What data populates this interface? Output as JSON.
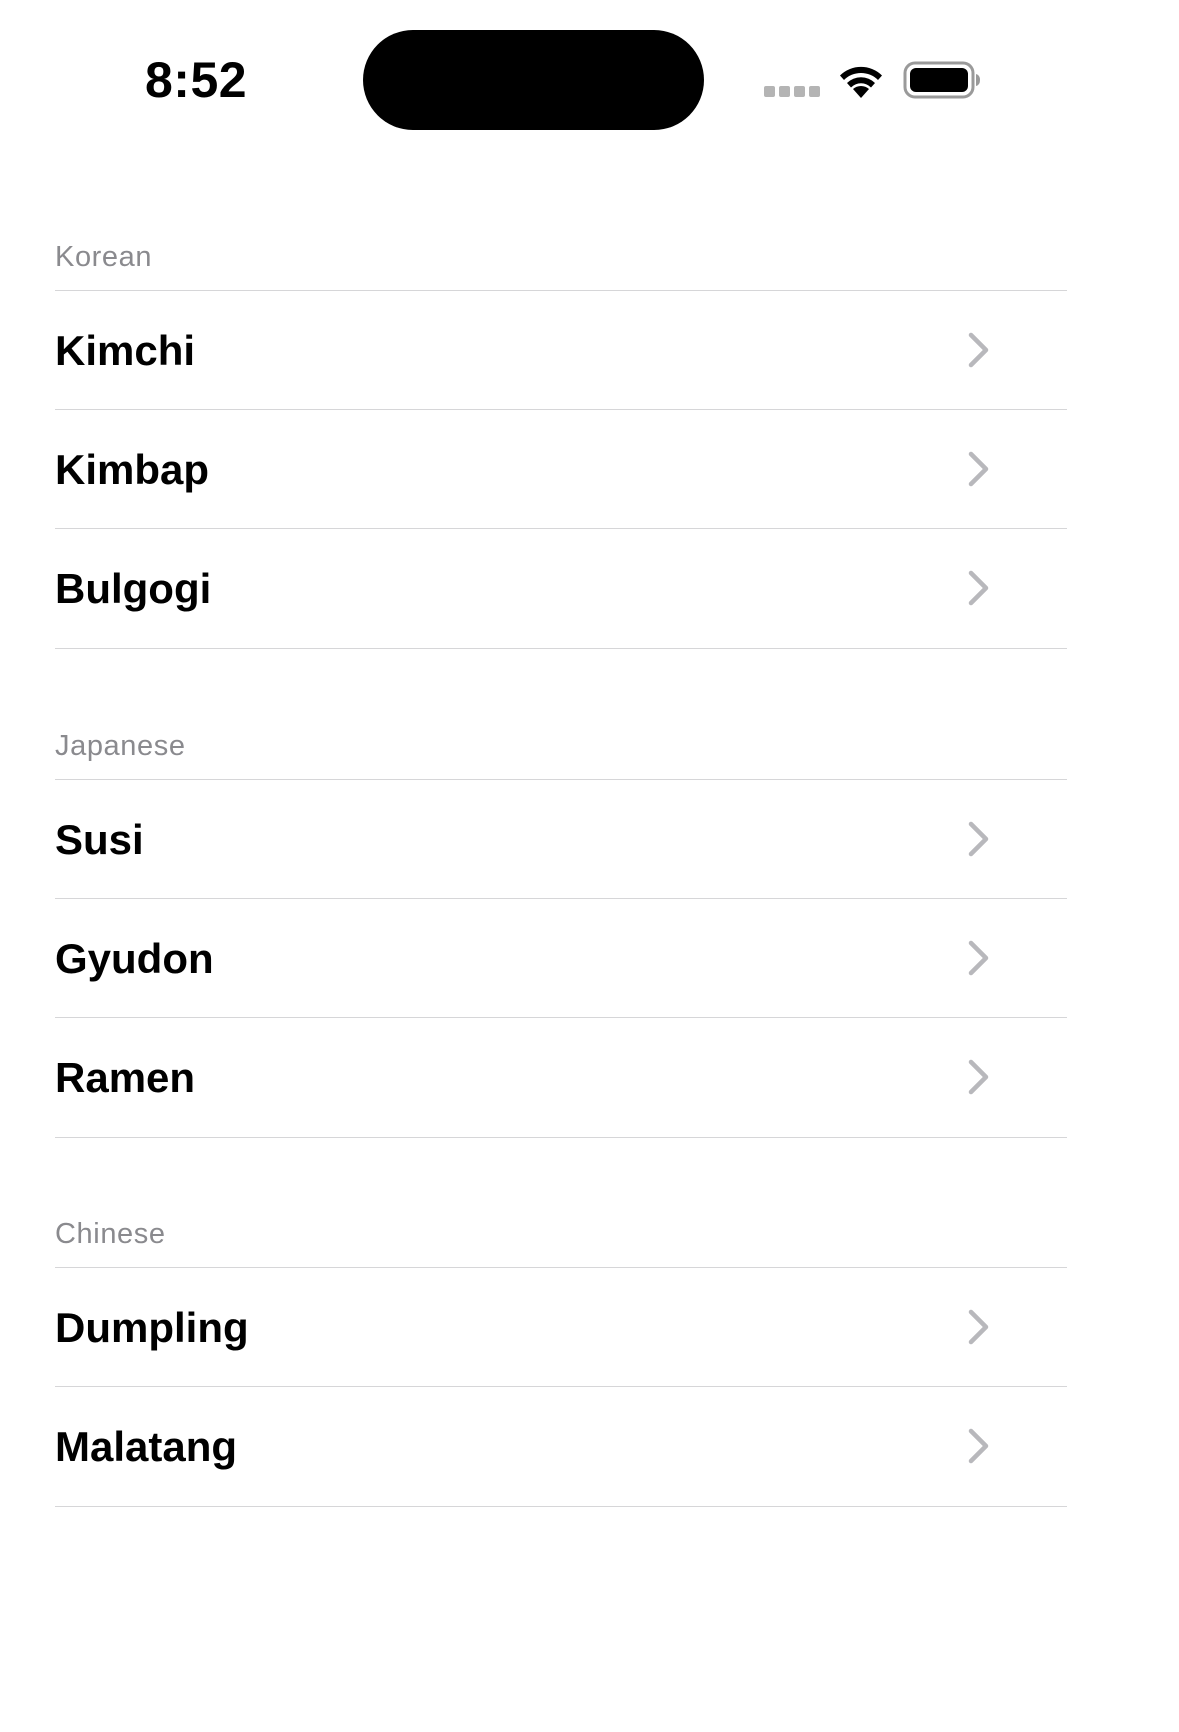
{
  "status_bar": {
    "time": "8:52"
  },
  "sections": [
    {
      "header": "Korean",
      "items": [
        "Kimchi",
        "Kimbap",
        "Bulgogi"
      ]
    },
    {
      "header": "Japanese",
      "items": [
        "Susi",
        "Gyudon",
        "Ramen"
      ]
    },
    {
      "header": "Chinese",
      "items": [
        "Dumpling",
        "Malatang"
      ]
    }
  ],
  "icons": {
    "row_accessory": "chevron-right-icon",
    "status": [
      "cellular-signal-icon",
      "wifi-icon",
      "battery-icon"
    ]
  },
  "colors": {
    "background": "#ffffff",
    "text": "#000000",
    "section_header": "#8a8a8e",
    "separator": "#d6d6d8",
    "chevron": "#b8b8bc"
  }
}
